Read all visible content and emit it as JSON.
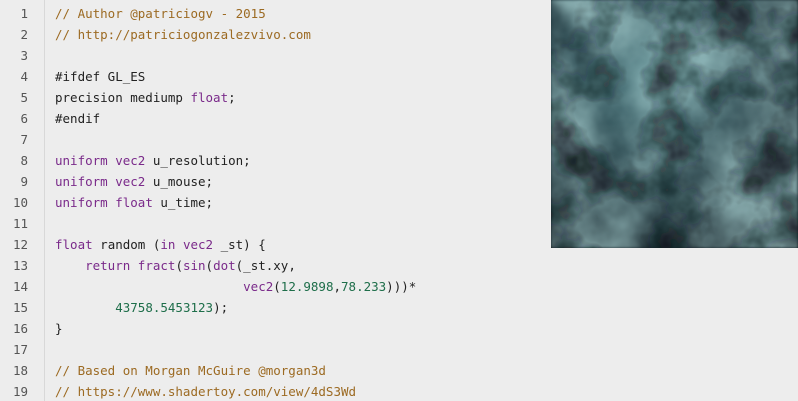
{
  "editor": {
    "lines": [
      {
        "n": "1",
        "tokens": [
          {
            "t": "// Author @patriciogv - 2015",
            "k": "comment"
          }
        ]
      },
      {
        "n": "2",
        "tokens": [
          {
            "t": "// http://patriciogonzalezvivo.com",
            "k": "comment"
          }
        ]
      },
      {
        "n": "3",
        "tokens": []
      },
      {
        "n": "4",
        "tokens": [
          {
            "t": "#ifdef GL_ES",
            "k": "plain"
          }
        ]
      },
      {
        "n": "5",
        "tokens": [
          {
            "t": "precision mediump ",
            "k": "plain"
          },
          {
            "t": "float",
            "k": "keyword"
          },
          {
            "t": ";",
            "k": "plain"
          }
        ]
      },
      {
        "n": "6",
        "tokens": [
          {
            "t": "#endif",
            "k": "plain"
          }
        ]
      },
      {
        "n": "7",
        "tokens": []
      },
      {
        "n": "8",
        "tokens": [
          {
            "t": "uniform",
            "k": "keyword"
          },
          {
            "t": " ",
            "k": "plain"
          },
          {
            "t": "vec2",
            "k": "keyword"
          },
          {
            "t": " u_resolution;",
            "k": "plain"
          }
        ]
      },
      {
        "n": "9",
        "tokens": [
          {
            "t": "uniform",
            "k": "keyword"
          },
          {
            "t": " ",
            "k": "plain"
          },
          {
            "t": "vec2",
            "k": "keyword"
          },
          {
            "t": " u_mouse;",
            "k": "plain"
          }
        ]
      },
      {
        "n": "10",
        "tokens": [
          {
            "t": "uniform",
            "k": "keyword"
          },
          {
            "t": " ",
            "k": "plain"
          },
          {
            "t": "float",
            "k": "keyword"
          },
          {
            "t": " u_time;",
            "k": "plain"
          }
        ]
      },
      {
        "n": "11",
        "tokens": []
      },
      {
        "n": "12",
        "tokens": [
          {
            "t": "float",
            "k": "keyword"
          },
          {
            "t": " random (",
            "k": "plain"
          },
          {
            "t": "in",
            "k": "keyword"
          },
          {
            "t": " ",
            "k": "plain"
          },
          {
            "t": "vec2",
            "k": "keyword"
          },
          {
            "t": " _st) {",
            "k": "plain"
          }
        ]
      },
      {
        "n": "13",
        "tokens": [
          {
            "t": "    ",
            "k": "plain"
          },
          {
            "t": "return",
            "k": "keyword"
          },
          {
            "t": " ",
            "k": "plain"
          },
          {
            "t": "fract",
            "k": "keyword"
          },
          {
            "t": "(",
            "k": "plain"
          },
          {
            "t": "sin",
            "k": "keyword"
          },
          {
            "t": "(",
            "k": "plain"
          },
          {
            "t": "dot",
            "k": "keyword"
          },
          {
            "t": "(_st.xy,",
            "k": "plain"
          }
        ]
      },
      {
        "n": "14",
        "tokens": [
          {
            "t": "                         ",
            "k": "plain"
          },
          {
            "t": "vec2",
            "k": "keyword"
          },
          {
            "t": "(",
            "k": "plain"
          },
          {
            "t": "12.9898",
            "k": "number"
          },
          {
            "t": ",",
            "k": "plain"
          },
          {
            "t": "78.233",
            "k": "number"
          },
          {
            "t": ")))*",
            "k": "plain"
          }
        ]
      },
      {
        "n": "15",
        "tokens": [
          {
            "t": "        ",
            "k": "plain"
          },
          {
            "t": "43758.5453123",
            "k": "number"
          },
          {
            "t": ");",
            "k": "plain"
          }
        ]
      },
      {
        "n": "16",
        "tokens": [
          {
            "t": "}",
            "k": "plain"
          }
        ]
      },
      {
        "n": "17",
        "tokens": []
      },
      {
        "n": "18",
        "tokens": [
          {
            "t": "// Based on Morgan McGuire @morgan3d",
            "k": "comment"
          }
        ]
      },
      {
        "n": "19",
        "tokens": [
          {
            "t": "// https://www.shadertoy.com/view/4dS3Wd",
            "k": "comment"
          }
        ]
      }
    ]
  },
  "preview": {
    "label": "shader-preview",
    "colors": {
      "dark": "#0f1a20",
      "mid": "#3e6a72",
      "light": "#9ec6c8"
    }
  }
}
